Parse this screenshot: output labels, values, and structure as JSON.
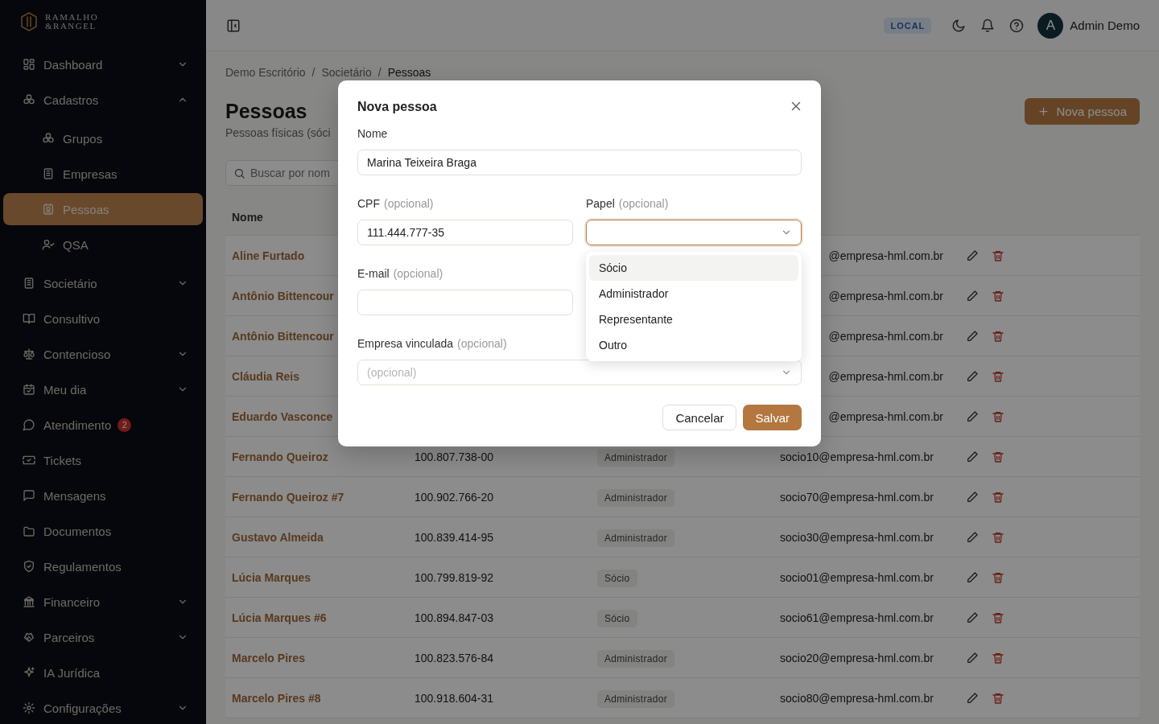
{
  "sidebar": {
    "logo": {
      "line1": "RAMALHO",
      "line2": "&RANGEL"
    },
    "items": [
      {
        "label": "Dashboard",
        "expanded": false,
        "selected": false
      },
      {
        "label": "Cadastros",
        "expanded": true,
        "selected": false,
        "children": [
          {
            "label": "Grupos",
            "selected": false
          },
          {
            "label": "Empresas",
            "selected": false
          },
          {
            "label": "Pessoas",
            "selected": true
          },
          {
            "label": "QSA",
            "selected": false
          }
        ]
      },
      {
        "label": "Societário",
        "expanded": false,
        "selected": false
      },
      {
        "label": "Consultivo",
        "selected": false
      },
      {
        "label": "Contencioso",
        "expanded": false,
        "selected": false
      },
      {
        "label": "Meu dia",
        "expanded": false,
        "selected": false
      },
      {
        "label": "Atendimento",
        "badge": "2",
        "selected": false
      },
      {
        "label": "Tickets",
        "selected": false
      },
      {
        "label": "Mensagens",
        "selected": false
      },
      {
        "label": "Documentos",
        "selected": false
      },
      {
        "label": "Regulamentos",
        "selected": false
      },
      {
        "label": "Financeiro",
        "expanded": false,
        "selected": false
      },
      {
        "label": "Parceiros",
        "expanded": false,
        "selected": false
      },
      {
        "label": "IA Jurídica",
        "selected": false
      },
      {
        "label": "Configurações",
        "expanded": false,
        "selected": false
      }
    ]
  },
  "topbar": {
    "environment": "LOCAL",
    "user": {
      "initial": "A",
      "name": "Admin Demo"
    }
  },
  "page": {
    "breadcrumbs": [
      {
        "kind": "link",
        "label": "Demo Escritório"
      },
      {
        "kind": "separator",
        "label": "/"
      },
      {
        "kind": "link",
        "label": "Societário"
      },
      {
        "kind": "separator",
        "label": "/"
      },
      {
        "kind": "current",
        "label": "Pessoas"
      }
    ],
    "title": "Pessoas",
    "subtitle": "Pessoas físicas (sóci",
    "search": {
      "placeholder": "Buscar por nom"
    },
    "primary_button": "Nova pessoa"
  },
  "table": {
    "columns": [
      "Nome"
    ],
    "rows": [
      {
        "name": "Aline Furtado",
        "email": "@empresa-hml.com.br"
      },
      {
        "name": "Antônio Bittencour",
        "email": "@empresa-hml.com.br"
      },
      {
        "name": "Antônio Bittencour",
        "email": "@empresa-hml.com.br"
      },
      {
        "name": "Cláudia Reis",
        "email": "@empresa-hml.com.br"
      },
      {
        "name": "Eduardo Vasconce",
        "email": "@empresa-hml.com.br"
      },
      {
        "name": "Fernando Queiroz",
        "cpf": "100.807.738-00",
        "role": "Administrador",
        "email": "socio10@empresa-hml.com.br"
      },
      {
        "name": "Fernando Queiroz #7",
        "cpf": "100.902.766-20",
        "role": "Administrador",
        "email": "socio70@empresa-hml.com.br"
      },
      {
        "name": "Gustavo Almeida",
        "cpf": "100.839.414-95",
        "role": "Administrador",
        "email": "socio30@empresa-hml.com.br"
      },
      {
        "name": "Lúcia Marques",
        "cpf": "100.799.819-92",
        "role": "Sócio",
        "email": "socio01@empresa-hml.com.br"
      },
      {
        "name": "Lúcia Marques #6",
        "cpf": "100.894.847-03",
        "role": "Sócio",
        "email": "socio61@empresa-hml.com.br"
      },
      {
        "name": "Marcelo Pires",
        "cpf": "100.823.576-84",
        "role": "Administrador",
        "email": "socio20@empresa-hml.com.br"
      },
      {
        "name": "Marcelo Pires #8",
        "cpf": "100.918.604-31",
        "role": "Administrador",
        "email": "socio80@empresa-hml.com.br"
      }
    ]
  },
  "modal": {
    "title": "Nova pessoa",
    "field_rows": [
      [
        {
          "kind": "text",
          "label": "Nome",
          "value": "Marina Teixeira Braga"
        }
      ],
      [
        {
          "kind": "text",
          "label": "CPF",
          "hint": "(opcional)",
          "value": "111.444.777-35"
        },
        {
          "kind": "select",
          "label": "Papel",
          "hint": "(opcional)",
          "focused": true,
          "open": true,
          "options": [
            {
              "label": "Sócio",
              "selected": true
            },
            {
              "label": "Administrador",
              "selected": false
            },
            {
              "label": "Representante",
              "selected": false
            },
            {
              "label": "Outro",
              "selected": false
            }
          ]
        }
      ],
      [
        {
          "kind": "text",
          "label": "E-mail",
          "hint": "(opcional)"
        }
      ],
      [
        {
          "kind": "select",
          "label": "Empresa vinculada",
          "hint": "(opcional)",
          "placeholder": "(opcional)",
          "focused": false,
          "open": false
        }
      ]
    ],
    "buttons": [
      {
        "label": "Cancelar",
        "kind": "secondary"
      },
      {
        "label": "Salvar",
        "kind": "primary"
      }
    ]
  }
}
